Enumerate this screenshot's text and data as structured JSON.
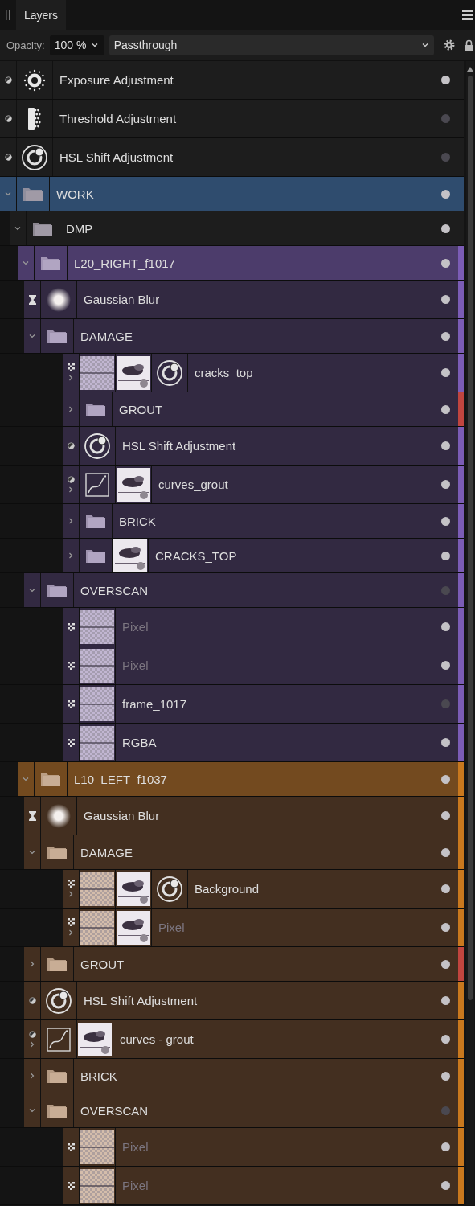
{
  "panel": {
    "tabs": [
      {
        "label": "Layers",
        "selected": true
      }
    ]
  },
  "options": {
    "opacity_label": "Opacity:",
    "opacity": "100 %",
    "blend_mode": "Passthrough"
  },
  "layers": [
    {
      "name": "Exposure Adjustment",
      "kind": "adjustment",
      "thumbs": [
        {
          "kind": "exposure"
        }
      ],
      "visible": true,
      "selected": false
    },
    {
      "name": "Threshold Adjustment",
      "kind": "adjustment",
      "thumbs": [
        {
          "kind": "threshold"
        }
      ],
      "visible": false,
      "selected": false
    },
    {
      "name": "HSL Shift Adjustment",
      "kind": "adjustment",
      "thumbs": [
        {
          "kind": "hsl"
        }
      ],
      "visible": false,
      "selected": false
    },
    {
      "name": "WORK",
      "kind": "folder",
      "expanded": true,
      "thumbs": [
        {
          "kind": "folder"
        }
      ],
      "visible": true,
      "selected": true,
      "children": [
        {
          "name": "DMP",
          "kind": "folder",
          "expanded": true,
          "thumbs": [
            {
              "kind": "folder"
            }
          ],
          "visible": true,
          "selected": false,
          "children": [
            {
              "name": "L20_RIGHT_f1017",
              "kind": "folder",
              "expanded": true,
              "color": "#7b5cb5",
              "thumbs": [
                {
                  "kind": "folder"
                }
              ],
              "visible": true,
              "selected": false,
              "children": [
                {
                  "name": "Gaussian Blur",
                  "kind": "filter",
                  "thumbs": [
                    {
                      "kind": "blur"
                    }
                  ],
                  "visible": true,
                  "selected": false
                },
                {
                  "name": "DAMAGE",
                  "kind": "folder",
                  "expanded": true,
                  "thumbs": [
                    {
                      "kind": "folder"
                    }
                  ],
                  "visible": true,
                  "selected": false,
                  "children": [
                    {
                      "name": "cracks_top",
                      "kind": "pixel",
                      "expanded": false,
                      "thumbs": [
                        {
                          "kind": "checker"
                        },
                        {
                          "kind": "mask"
                        },
                        {
                          "kind": "hsl"
                        }
                      ],
                      "visible": true,
                      "selected": false
                    },
                    {
                      "name": "GROUT",
                      "kind": "folder",
                      "expanded": false,
                      "color": "#c0453f",
                      "thumbs": [
                        {
                          "kind": "folder"
                        }
                      ],
                      "visible": true,
                      "selected": false
                    },
                    {
                      "name": "HSL Shift Adjustment",
                      "kind": "adjustment",
                      "thumbs": [
                        {
                          "kind": "hsl"
                        }
                      ],
                      "visible": true,
                      "selected": false
                    },
                    {
                      "name": "curves_grout",
                      "kind": "adjustment",
                      "expanded": false,
                      "thumbs": [
                        {
                          "kind": "curves"
                        },
                        {
                          "kind": "mask"
                        }
                      ],
                      "visible": true,
                      "selected": false
                    },
                    {
                      "name": "BRICK",
                      "kind": "folder",
                      "expanded": false,
                      "thumbs": [
                        {
                          "kind": "folder"
                        }
                      ],
                      "visible": true,
                      "selected": false
                    },
                    {
                      "name": "CRACKS_TOP",
                      "kind": "folder",
                      "expanded": false,
                      "thumbs": [
                        {
                          "kind": "folder"
                        },
                        {
                          "kind": "mask"
                        }
                      ],
                      "visible": true,
                      "selected": false
                    }
                  ]
                },
                {
                  "name": "OVERSCAN",
                  "kind": "folder",
                  "expanded": true,
                  "thumbs": [
                    {
                      "kind": "folder"
                    }
                  ],
                  "visible": false,
                  "selected": false,
                  "children": [
                    {
                      "name": "Pixel",
                      "kind": "pixel",
                      "disabled": true,
                      "thumbs": [
                        {
                          "kind": "checker"
                        }
                      ],
                      "visible": true,
                      "selected": false
                    },
                    {
                      "name": "Pixel",
                      "kind": "pixel",
                      "disabled": true,
                      "thumbs": [
                        {
                          "kind": "checker"
                        }
                      ],
                      "visible": true,
                      "selected": false
                    },
                    {
                      "name": "frame_1017",
                      "kind": "pixel",
                      "disabled": false,
                      "thumbs": [
                        {
                          "kind": "checker"
                        }
                      ],
                      "visible": false,
                      "selected": false
                    },
                    {
                      "name": "RGBA",
                      "kind": "pixel",
                      "disabled": false,
                      "thumbs": [
                        {
                          "kind": "checker"
                        }
                      ],
                      "visible": true,
                      "selected": false
                    }
                  ]
                }
              ]
            },
            {
              "name": "L10_LEFT_f1037",
              "kind": "folder",
              "expanded": true,
              "color": "#c8781e",
              "thumbs": [
                {
                  "kind": "folder"
                }
              ],
              "visible": true,
              "selected": false,
              "children": [
                {
                  "name": "Gaussian Blur",
                  "kind": "filter",
                  "thumbs": [
                    {
                      "kind": "blur"
                    }
                  ],
                  "visible": true,
                  "selected": false
                },
                {
                  "name": "DAMAGE",
                  "kind": "folder",
                  "expanded": true,
                  "thumbs": [
                    {
                      "kind": "folder"
                    }
                  ],
                  "visible": true,
                  "selected": false,
                  "children": [
                    {
                      "name": "Background",
                      "kind": "pixel",
                      "expanded": false,
                      "disabled": false,
                      "thumbs": [
                        {
                          "kind": "checker"
                        },
                        {
                          "kind": "mask"
                        },
                        {
                          "kind": "hsl"
                        }
                      ],
                      "visible": true,
                      "selected": false
                    },
                    {
                      "name": "Pixel",
                      "kind": "pixel",
                      "expanded": false,
                      "disabled": true,
                      "thumbs": [
                        {
                          "kind": "checker"
                        },
                        {
                          "kind": "mask"
                        }
                      ],
                      "visible": true,
                      "selected": false
                    }
                  ]
                },
                {
                  "name": "GROUT",
                  "kind": "folder",
                  "expanded": false,
                  "color": "#c0453f",
                  "thumbs": [
                    {
                      "kind": "folder"
                    }
                  ],
                  "visible": true,
                  "selected": false
                },
                {
                  "name": "HSL Shift Adjustment",
                  "kind": "adjustment",
                  "thumbs": [
                    {
                      "kind": "hsl"
                    }
                  ],
                  "visible": true,
                  "selected": false
                },
                {
                  "name": "curves - grout",
                  "kind": "adjustment",
                  "expanded": false,
                  "thumbs": [
                    {
                      "kind": "curves"
                    },
                    {
                      "kind": "mask"
                    }
                  ],
                  "visible": true,
                  "selected": false
                },
                {
                  "name": "BRICK",
                  "kind": "folder",
                  "expanded": false,
                  "thumbs": [
                    {
                      "kind": "folder"
                    }
                  ],
                  "visible": true,
                  "selected": false
                },
                {
                  "name": "OVERSCAN",
                  "kind": "folder",
                  "expanded": true,
                  "thumbs": [
                    {
                      "kind": "folder"
                    }
                  ],
                  "visible": false,
                  "selected": false,
                  "children": [
                    {
                      "name": "Pixel",
                      "kind": "pixel",
                      "disabled": true,
                      "thumbs": [
                        {
                          "kind": "checker"
                        }
                      ],
                      "visible": true,
                      "selected": false
                    },
                    {
                      "name": "Pixel",
                      "kind": "pixel",
                      "disabled": true,
                      "thumbs": [
                        {
                          "kind": "checker"
                        }
                      ],
                      "visible": true,
                      "selected": false
                    }
                  ]
                }
              ]
            }
          ]
        }
      ]
    }
  ]
}
